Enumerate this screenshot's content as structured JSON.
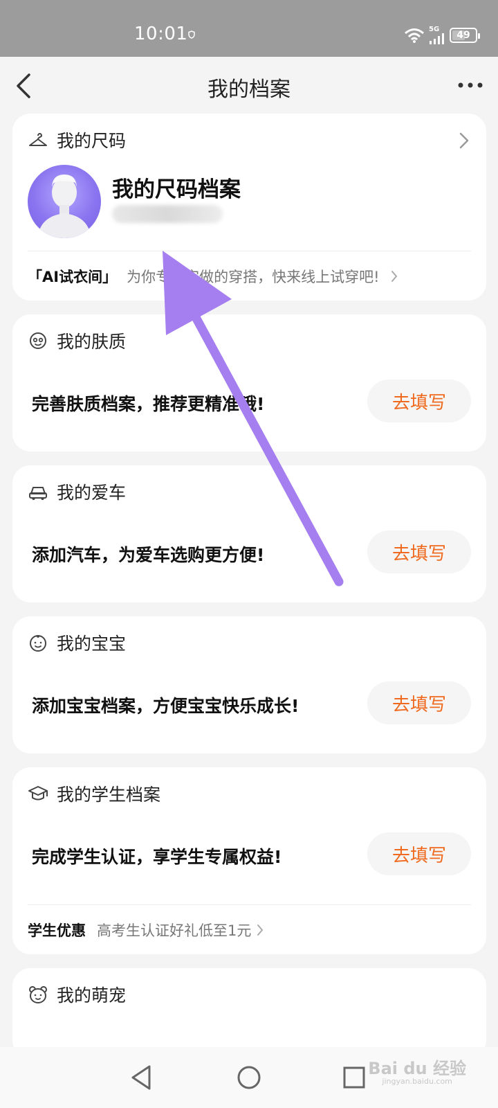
{
  "status_bar": {
    "time": "10:01",
    "network": "5G",
    "battery": "49",
    "battery_level": 0.49
  },
  "nav": {
    "title": "我的档案",
    "back_icon": "chevron-left-icon",
    "more_icon": "more-icon"
  },
  "size_card": {
    "title": "我的尺码",
    "icon": "hanger-icon",
    "heading": "我的尺码档案",
    "ai_tag": "「AI试衣间」",
    "ai_text": "为你专属定做的穿搭，快来线上试穿吧!"
  },
  "skin_card": {
    "title": "我的肤质",
    "icon": "face-icon",
    "message": "完善肤质档案，推荐更精准哦!",
    "button": "去填写"
  },
  "car_card": {
    "title": "我的爱车",
    "icon": "car-icon",
    "message": "添加汽车，为爱车选购更方便!",
    "button": "去填写"
  },
  "baby_card": {
    "title": "我的宝宝",
    "icon": "baby-icon",
    "message": "添加宝宝档案，方便宝宝快乐成长!",
    "button": "去填写"
  },
  "student_card": {
    "title": "我的学生档案",
    "icon": "graduation-cap-icon",
    "message": "完成学生认证，享学生专属权益!",
    "button": "去填写",
    "promo_tag": "学生优惠",
    "promo_text": "高考生认证好礼低至1元"
  },
  "pet_card": {
    "title": "我的萌宠",
    "icon": "bear-icon"
  },
  "watermark": {
    "brand": "Bai du 经验",
    "site": "jingyan.baidu.com"
  },
  "colors": {
    "accent": "#ef6a1e",
    "arrow": "#a57ef0",
    "background": "#f4f4f4"
  }
}
